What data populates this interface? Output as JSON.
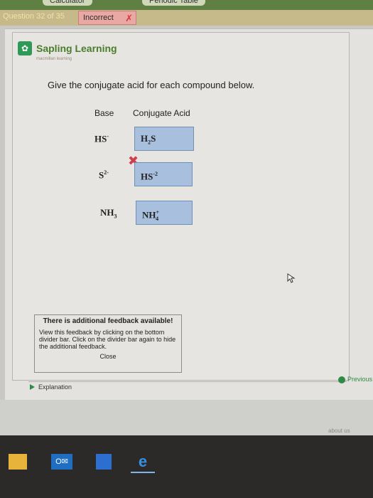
{
  "top_tabs": [
    "Calculator",
    "Periodic Table"
  ],
  "question_progress": "Question 32 of 35",
  "status_badge": "Incorrect",
  "brand": {
    "name": "Sapling Learning",
    "tagline": "macmillan learning"
  },
  "question": "Give the conjugate acid for each compound below.",
  "table": {
    "headers": [
      "Base",
      "Conjugate Acid"
    ],
    "rows": [
      {
        "base": "HS",
        "base_sup": "-",
        "answer": "H",
        "answer_sub": "2",
        "answer_tail": "S"
      },
      {
        "base": "S",
        "base_sup": "2-",
        "answer": "HS",
        "answer_sup": "-2"
      },
      {
        "base": "NH",
        "base_sub": "3",
        "answer": "NH",
        "answer_sup": "+",
        "answer_sub": "4"
      }
    ]
  },
  "feedback": {
    "title": "There is additional feedback available!",
    "body": "View this feedback by clicking on the bottom divider bar. Click on the divider bar again to hide the additional feedback.",
    "close": "Close"
  },
  "explanation_label": "Explanation",
  "previous_label": "Previous",
  "footer_link": "about us",
  "icons": [
    "sapling-logo-icon",
    "wrong-x-icon",
    "cursor-icon",
    "file-explorer-icon",
    "outlook-icon",
    "store-icon",
    "edge-icon"
  ]
}
